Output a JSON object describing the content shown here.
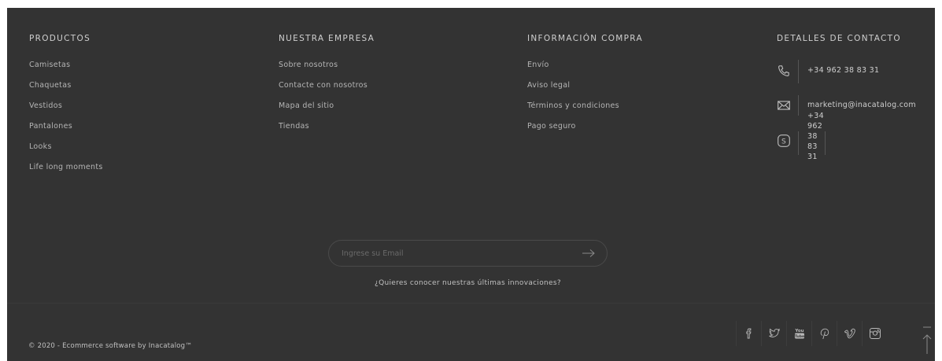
{
  "columns": [
    {
      "title": "PRODUCTOS",
      "items": [
        "Camisetas",
        "Chaquetas",
        "Vestidos",
        "Pantalones",
        "Looks",
        "Life long moments"
      ]
    },
    {
      "title": "NUESTRA EMPRESA",
      "items": [
        "Sobre nosotros",
        "Contacte con nosotros",
        "Mapa del sitio",
        "Tiendas"
      ]
    },
    {
      "title": "INFORMACIÓN COMPRA",
      "items": [
        "Envío",
        "Aviso legal",
        "Términos y condiciones",
        "Pago seguro"
      ]
    }
  ],
  "contact": {
    "title": "DETALLES DE CONTACTO",
    "phone": "+34 962 38 83 31",
    "email": "marketing@inacatalog.com",
    "skype_lines": [
      "+34",
      "962",
      "38",
      "83",
      "31"
    ]
  },
  "newsletter": {
    "placeholder": "Ingrese su Email",
    "caption": "¿Quieres conocer nuestras últimas innovaciones?"
  },
  "copyright": "© 2020 - Ecommerce software by Inacatalog™",
  "social": [
    "facebook-icon",
    "twitter-icon",
    "youtube-icon",
    "pinterest-icon",
    "vimeo-icon",
    "instagram-icon"
  ],
  "colors": {
    "background": "#333333",
    "text": "#c8c8c8"
  }
}
